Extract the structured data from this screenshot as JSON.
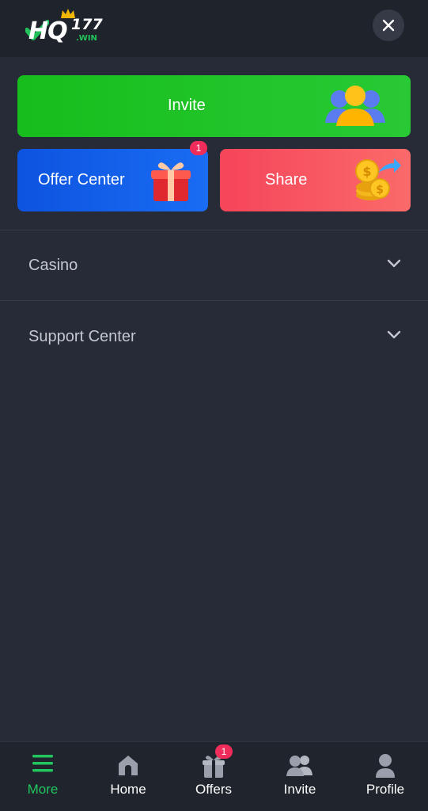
{
  "header": {
    "logo_main": "HQ",
    "logo_number": "177",
    "logo_suffix": ".WIN",
    "close_icon": "close-icon"
  },
  "cards": {
    "invite": {
      "label": "Invite",
      "icon": "users-icon",
      "color": "#22c52a"
    },
    "offer_center": {
      "label": "Offer Center",
      "icon": "gift-icon",
      "badge": "1",
      "color": "#1a6cf3"
    },
    "share": {
      "label": "Share",
      "icon": "coins-icon",
      "color": "#f95a63"
    }
  },
  "menu": {
    "casino": {
      "label": "Casino",
      "icon": "chevron-down-icon"
    },
    "support": {
      "label": "Support Center",
      "icon": "chevron-down-icon"
    }
  },
  "tabbar": {
    "accent": "#22c55e",
    "tabs": [
      {
        "label": "More",
        "icon": "menu-icon",
        "active": true
      },
      {
        "label": "Home",
        "icon": "home-icon"
      },
      {
        "label": "Offers",
        "icon": "gift-icon",
        "badge": "1"
      },
      {
        "label": "Invite",
        "icon": "users-icon"
      },
      {
        "label": "Profile",
        "icon": "profile-icon"
      }
    ]
  }
}
